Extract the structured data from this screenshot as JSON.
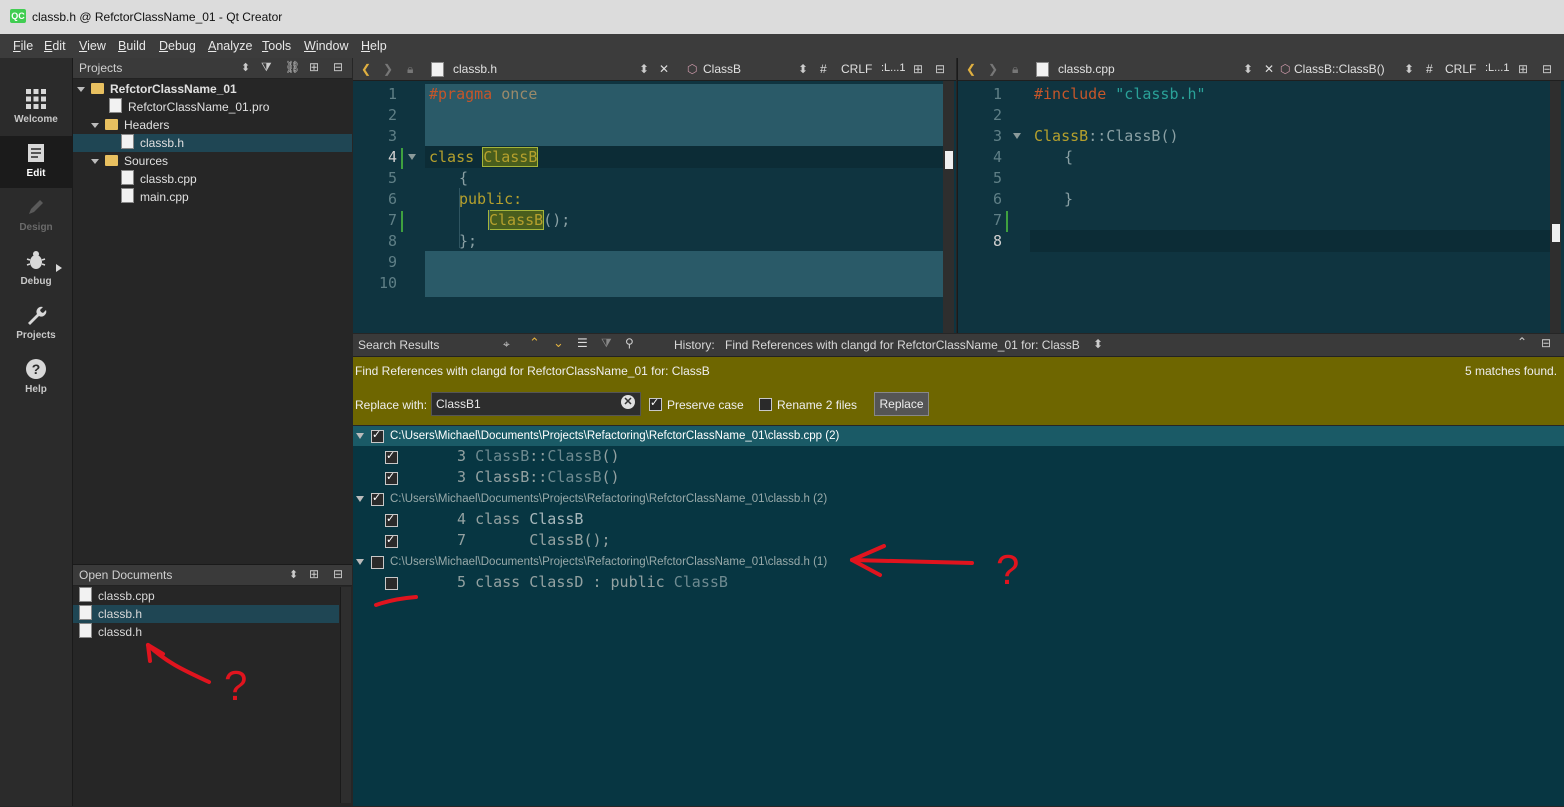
{
  "window": {
    "logo": "QC",
    "title": "classb.h @ RefctorClassName_01 - Qt Creator"
  },
  "menu": [
    "File",
    "Edit",
    "View",
    "Build",
    "Debug",
    "Analyze",
    "Tools",
    "Window",
    "Help"
  ],
  "modes": [
    {
      "label": "Welcome"
    },
    {
      "label": "Edit"
    },
    {
      "label": "Design"
    },
    {
      "label": "Debug"
    },
    {
      "label": "Projects"
    },
    {
      "label": "Help"
    }
  ],
  "projects": {
    "header": "Projects",
    "root": "RefctorClassName_01",
    "pro": "RefctorClassName_01.pro",
    "headers": "Headers",
    "header_file": "classb.h",
    "sources": "Sources",
    "src1": "classb.cpp",
    "src2": "main.cpp"
  },
  "open_docs": {
    "header": "Open Documents",
    "items": [
      "classb.cpp",
      "classb.h",
      "classd.h"
    ]
  },
  "editor_left": {
    "file": "classb.h",
    "symbol": "ClassB",
    "hash": "#",
    "eol": "CRLF",
    "pos": ":L...1",
    "line_numbers": [
      "1",
      "2",
      "3",
      "4",
      "5",
      "6",
      "7",
      "8",
      "9",
      "10"
    ],
    "l1_pp": "#pragma",
    "l1_rest": " once",
    "l4_kw": "class ",
    "l4_ident": "ClassB",
    "l5": "{",
    "l6": "public:",
    "l7_ident": "ClassB",
    "l7_rest": "();",
    "l8": "};"
  },
  "editor_right": {
    "file": "classb.cpp",
    "symbol": "ClassB::ClassB()",
    "hash": "#",
    "eol": "CRLF",
    "pos": ":L...1",
    "line_numbers": [
      "1",
      "2",
      "3",
      "4",
      "5",
      "6",
      "7",
      "8"
    ],
    "l1_pp": "#include",
    "l1_str": " \"classb.h\"",
    "l3_a": "ClassB",
    "l3_b": "::",
    "l3_c": "ClassB",
    "l3_d": "()",
    "l4": "{",
    "l6": "}"
  },
  "search": {
    "title": "Search Results",
    "history_label": "History:",
    "history_value": "Find References with clangd for RefctorClassName_01 for: ClassB",
    "info": "Find References with clangd for RefctorClassName_01 for:  ClassB",
    "matches": "5 matches found.",
    "replace_label": "Replace with:",
    "replace_value": "ClassB1",
    "preserve_case": "Preserve case",
    "rename_files": "Rename 2 files",
    "replace_button": "Replace",
    "groups": [
      {
        "path": "C:\\Users\\Michael\\Documents\\Projects\\Refactoring\\RefctorClassName_01\\classb.cpp (2)",
        "lines": [
          {
            "num": "3",
            "pre": "",
            "match": "ClassB",
            "mid": "::",
            "match2": "ClassB",
            "post": "()"
          },
          {
            "num": "3",
            "pre": "",
            "match": "ClassB",
            "mid": "::",
            "match2": "ClassB",
            "post": "()"
          }
        ]
      },
      {
        "path": "C:\\Users\\Michael\\Documents\\Projects\\Refactoring\\RefctorClassName_01\\classb.h (2)",
        "lines": [
          {
            "num": "4",
            "pre": "class ",
            "match": "ClassB",
            "post": ""
          },
          {
            "num": "7",
            "pre": "      ",
            "match": "ClassB",
            "post": "();"
          }
        ]
      },
      {
        "path": "C:\\Users\\Michael\\Documents\\Projects\\Refactoring\\RefctorClassName_01\\classd.h (1)",
        "lines": [
          {
            "num": "5",
            "pre": "class ClassD : public ",
            "match": "ClassB",
            "post": ""
          }
        ]
      }
    ]
  },
  "annotations": {
    "q1": "?",
    "q2": "?"
  },
  "colors": {
    "editor_bg": "#0f3440",
    "info_bar": "#6e6600",
    "annotation": "#e0141e"
  }
}
